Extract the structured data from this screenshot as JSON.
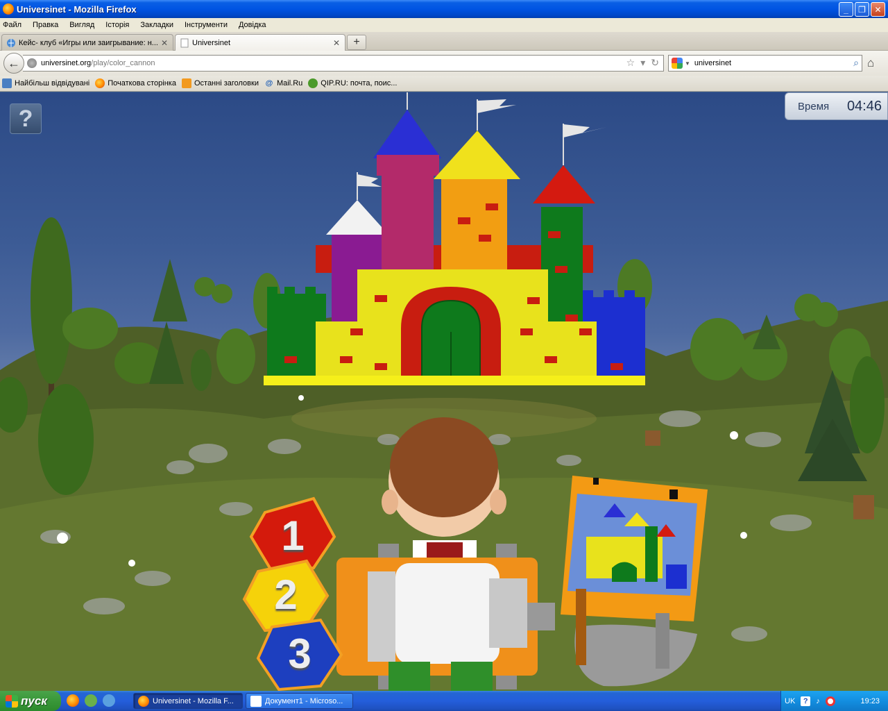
{
  "window": {
    "title": "Universinet - Mozilla Firefox",
    "controls": {
      "minimize": "_",
      "maximize": "❐",
      "close": "✕"
    }
  },
  "menu": [
    "Файл",
    "Правка",
    "Вигляд",
    "Історія",
    "Закладки",
    "Інструменти",
    "Довідка"
  ],
  "tabs": [
    {
      "label": "Кейс- клуб «Игры или заигрывание: н...",
      "active": false
    },
    {
      "label": "Universinet",
      "active": true
    }
  ],
  "new_tab": "+",
  "nav": {
    "url_host": "universinet.org",
    "url_path": "/play/color_cannon",
    "search_value": "universinet"
  },
  "bookmarks": [
    {
      "label": "Найбільш відвідувані",
      "icon": "blue"
    },
    {
      "label": "Початкова сторінка",
      "icon": "firefox"
    },
    {
      "label": "Останні заголовки",
      "icon": "rss"
    },
    {
      "label": "Mail.Ru",
      "icon": "at"
    },
    {
      "label": "QIP.RU: почта, поис...",
      "icon": "qip"
    }
  ],
  "game": {
    "help_label": "?",
    "timer_label": "Время",
    "timer_value": "04:46",
    "color_buttons": [
      {
        "number": "1",
        "color": "#d41a0c"
      },
      {
        "number": "2",
        "color": "#f5d20a"
      },
      {
        "number": "3",
        "color": "#1d3fbf"
      }
    ]
  },
  "taskbar": {
    "start_label": "пуск",
    "tasks": [
      {
        "label": "Universinet - Mozilla F...",
        "active": true
      },
      {
        "label": "Документ1 - Microso...",
        "active": false
      }
    ],
    "lang": "UK",
    "help": "?",
    "clock": "19:23"
  },
  "colors": {
    "xp_blue": "#0054e3",
    "sky": "#3c5b95",
    "grass": "#56682a",
    "castle_yellow": "#e8e21c"
  }
}
